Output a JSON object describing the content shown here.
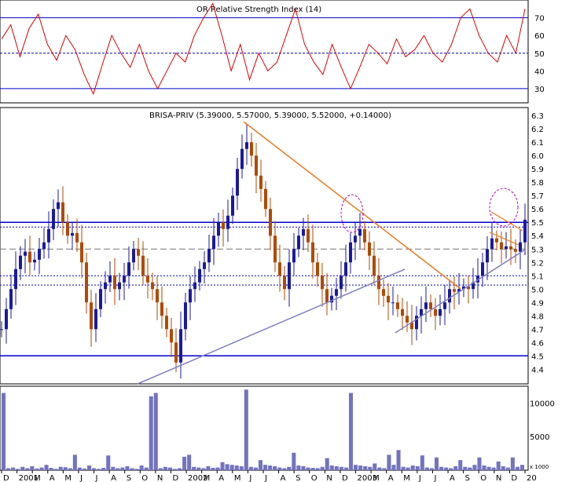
{
  "chart_data": [
    {
      "panel": "indicator",
      "type": "line",
      "title": "OR Relative Strength Index (14)",
      "y_ticks": [
        30,
        40,
        50,
        60,
        70
      ],
      "ylim": [
        22,
        80
      ],
      "reference_lines": {
        "upper": 70,
        "mid": 50,
        "lower": 30
      },
      "series_color": "#e00000",
      "series": [
        {
          "x": 0,
          "y": 58
        },
        {
          "x": 3,
          "y": 66
        },
        {
          "x": 6,
          "y": 48
        },
        {
          "x": 9,
          "y": 64
        },
        {
          "x": 12,
          "y": 72
        },
        {
          "x": 15,
          "y": 55
        },
        {
          "x": 18,
          "y": 46
        },
        {
          "x": 21,
          "y": 60
        },
        {
          "x": 24,
          "y": 52
        },
        {
          "x": 27,
          "y": 38
        },
        {
          "x": 30,
          "y": 27
        },
        {
          "x": 33,
          "y": 44
        },
        {
          "x": 36,
          "y": 60
        },
        {
          "x": 39,
          "y": 50
        },
        {
          "x": 42,
          "y": 42
        },
        {
          "x": 45,
          "y": 55
        },
        {
          "x": 48,
          "y": 40
        },
        {
          "x": 51,
          "y": 30
        },
        {
          "x": 54,
          "y": 40
        },
        {
          "x": 57,
          "y": 50
        },
        {
          "x": 60,
          "y": 45
        },
        {
          "x": 63,
          "y": 60
        },
        {
          "x": 66,
          "y": 70
        },
        {
          "x": 69,
          "y": 78
        },
        {
          "x": 72,
          "y": 60
        },
        {
          "x": 75,
          "y": 40
        },
        {
          "x": 78,
          "y": 55
        },
        {
          "x": 81,
          "y": 35
        },
        {
          "x": 84,
          "y": 50
        },
        {
          "x": 87,
          "y": 40
        },
        {
          "x": 90,
          "y": 45
        },
        {
          "x": 93,
          "y": 60
        },
        {
          "x": 96,
          "y": 75
        },
        {
          "x": 99,
          "y": 55
        },
        {
          "x": 102,
          "y": 45
        },
        {
          "x": 105,
          "y": 38
        },
        {
          "x": 108,
          "y": 55
        },
        {
          "x": 111,
          "y": 42
        },
        {
          "x": 114,
          "y": 30
        },
        {
          "x": 117,
          "y": 42
        },
        {
          "x": 120,
          "y": 55
        },
        {
          "x": 123,
          "y": 50
        },
        {
          "x": 126,
          "y": 44
        },
        {
          "x": 129,
          "y": 58
        },
        {
          "x": 132,
          "y": 48
        },
        {
          "x": 135,
          "y": 52
        },
        {
          "x": 138,
          "y": 60
        },
        {
          "x": 141,
          "y": 50
        },
        {
          "x": 144,
          "y": 45
        },
        {
          "x": 147,
          "y": 55
        },
        {
          "x": 150,
          "y": 70
        },
        {
          "x": 153,
          "y": 75
        },
        {
          "x": 156,
          "y": 60
        },
        {
          "x": 159,
          "y": 50
        },
        {
          "x": 162,
          "y": 45
        },
        {
          "x": 165,
          "y": 60
        },
        {
          "x": 168,
          "y": 50
        },
        {
          "x": 171,
          "y": 75
        }
      ]
    },
    {
      "panel": "price",
      "type": "candlestick",
      "title": "BRISA-PRIV (5.39000, 5.57000, 5.39000, 5.52000, +0.14000)",
      "y_ticks": [
        4.4,
        4.5,
        4.6,
        4.7,
        4.8,
        4.9,
        5.0,
        5.1,
        5.2,
        5.3,
        5.4,
        5.5,
        5.6,
        5.7,
        5.8,
        5.9,
        6.0,
        6.1,
        6.2,
        6.3
      ],
      "ylim": [
        4.29,
        6.36
      ],
      "up_color": "#1a1aa0",
      "down_color": "#b04a00",
      "x_ticks": [
        "D",
        "2001",
        "M",
        "A",
        "M",
        "J",
        "J",
        "A",
        "S",
        "O",
        "N",
        "D",
        "2002",
        "M",
        "A",
        "M",
        "J",
        "J",
        "A",
        "S",
        "O",
        "N",
        "D",
        "2003",
        "M",
        "A",
        "M",
        "J",
        "J",
        "A",
        "S",
        "O",
        "N",
        "D",
        "20"
      ],
      "closes": [
        4.7,
        4.85,
        5.0,
        5.15,
        5.25,
        5.28,
        5.2,
        5.22,
        5.3,
        5.35,
        5.45,
        5.6,
        5.65,
        5.5,
        5.4,
        5.42,
        5.35,
        5.2,
        4.9,
        4.7,
        4.85,
        5.0,
        5.05,
        5.1,
        5.0,
        5.05,
        5.1,
        5.2,
        5.3,
        5.25,
        5.1,
        5.05,
        5.0,
        4.9,
        4.8,
        4.7,
        4.6,
        4.45,
        4.7,
        4.9,
        5.0,
        5.05,
        5.15,
        5.2,
        5.3,
        5.4,
        5.5,
        5.45,
        5.55,
        5.7,
        5.9,
        6.05,
        6.1,
        6.0,
        5.85,
        5.75,
        5.6,
        5.4,
        5.2,
        5.1,
        5.0,
        5.2,
        5.3,
        5.4,
        5.45,
        5.35,
        5.2,
        5.1,
        5.0,
        4.9,
        4.95,
        5.0,
        5.1,
        5.2,
        5.35,
        5.4,
        5.45,
        5.35,
        5.25,
        5.1,
        5.0,
        4.95,
        4.9,
        4.9,
        4.85,
        4.8,
        4.75,
        4.7,
        4.8,
        4.85,
        4.9,
        4.85,
        4.8,
        4.85,
        4.9,
        5.0,
        4.98,
        5.0,
        5.02,
        5.0,
        5.05,
        5.1,
        5.2,
        5.3,
        5.38,
        5.35,
        5.3,
        5.32,
        5.3,
        5.28,
        5.35,
        5.52
      ],
      "horizontal_lines": [
        {
          "y": 5.5,
          "style": "solid",
          "color": "#0000cc"
        },
        {
          "y": 5.465,
          "style": "dotted",
          "color": "#0000cc"
        },
        {
          "y": 5.3,
          "style": "dashed",
          "color": "#777777"
        },
        {
          "y": 5.1,
          "style": "dotted",
          "color": "#0000cc"
        },
        {
          "y": 5.03,
          "style": "dotted",
          "color": "#0000cc"
        },
        {
          "y": 4.5,
          "style": "solid",
          "color": "#0000cc"
        }
      ]
    },
    {
      "panel": "volume",
      "type": "bar",
      "title": "",
      "unit_label": "x 1000",
      "y_ticks": [
        5000,
        10000
      ],
      "ylim": [
        0,
        12500
      ],
      "bar_color": "#7373c0",
      "values": [
        11500,
        300,
        400,
        200,
        500,
        300,
        600,
        250,
        400,
        800,
        350,
        200,
        500,
        450,
        300,
        2300,
        400,
        250,
        700,
        300,
        200,
        350,
        2200,
        500,
        300,
        400,
        600,
        300,
        200,
        700,
        400,
        11000,
        11500,
        300,
        500,
        400,
        200,
        300,
        2000,
        2300,
        500,
        400,
        300,
        600,
        350,
        400,
        1200,
        900,
        800,
        700,
        600,
        12000,
        500,
        400,
        1500,
        800,
        700,
        600,
        400,
        300,
        500,
        2600,
        700,
        600,
        400,
        350,
        300,
        500,
        1800,
        700,
        600,
        500,
        400,
        11500,
        800,
        700,
        600,
        500,
        1000,
        400,
        300,
        2300,
        800,
        3000,
        500,
        400,
        700,
        600,
        2200,
        400,
        300,
        1900,
        500,
        400,
        300,
        600,
        1500,
        500,
        400,
        800,
        1900,
        700,
        500,
        400,
        1300,
        600,
        400,
        1900,
        500,
        800
      ]
    }
  ]
}
